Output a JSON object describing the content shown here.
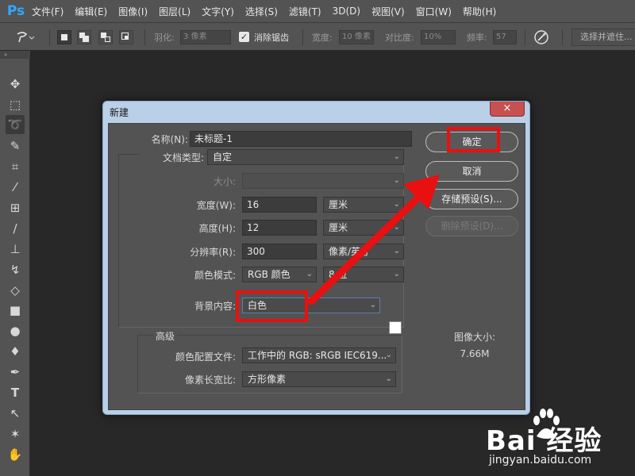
{
  "app": {
    "logo": "Ps"
  },
  "menu": [
    "文件(F)",
    "编辑(E)",
    "图像(I)",
    "图层(L)",
    "文字(Y)",
    "选择(S)",
    "滤镜(T)",
    "3D(D)",
    "视图(V)",
    "窗口(W)",
    "帮助(H)"
  ],
  "options_bar": {
    "tool_icon": "magnetic-lasso-icon",
    "feather_label": "羽化:",
    "feather_value": "3 像素",
    "antialias_label": "消除锯齿",
    "antialias_checked": true,
    "width_label": "宽度:",
    "width_value": "10 像素",
    "contrast_label": "对比度:",
    "contrast_value": "10%",
    "frequency_label": "频率:",
    "frequency_value": "57",
    "select_mask_label": "选择并遮住..."
  },
  "toolbar": {
    "collapse_glyph": "»",
    "tools": [
      {
        "name": "move-tool",
        "glyph": "✥"
      },
      {
        "name": "marquee-tool",
        "glyph": "⬚"
      },
      {
        "name": "lasso-tool",
        "glyph": "➰",
        "active": true
      },
      {
        "name": "quick-select-tool",
        "glyph": "✎"
      },
      {
        "name": "crop-tool",
        "glyph": "⌗"
      },
      {
        "name": "eyedropper-tool",
        "glyph": "⁄"
      },
      {
        "name": "healing-tool",
        "glyph": "⊞"
      },
      {
        "name": "brush-tool",
        "glyph": "∕"
      },
      {
        "name": "stamp-tool",
        "glyph": "⊥"
      },
      {
        "name": "history-brush-tool",
        "glyph": "↯"
      },
      {
        "name": "eraser-tool",
        "glyph": "◇"
      },
      {
        "name": "gradient-tool",
        "glyph": "■"
      },
      {
        "name": "blur-tool",
        "glyph": "●"
      },
      {
        "name": "dodge-tool",
        "glyph": "♦"
      },
      {
        "name": "pen-tool",
        "glyph": "✒"
      },
      {
        "name": "type-tool",
        "glyph": "T"
      },
      {
        "name": "path-select-tool",
        "glyph": "↖"
      },
      {
        "name": "shape-tool",
        "glyph": "✶"
      },
      {
        "name": "hand-tool",
        "glyph": "✋"
      }
    ]
  },
  "dialog": {
    "title": "新建",
    "close_glyph": "×",
    "name_label": "名称(N):",
    "name_value": "未标题-1",
    "doc_type_label": "文档类型:",
    "doc_type_value": "自定",
    "size_label": "大小:",
    "size_value": "",
    "width_label": "宽度(W):",
    "width_value": "16",
    "width_unit": "厘米",
    "height_label": "高度(H):",
    "height_value": "12",
    "height_unit": "厘米",
    "resolution_label": "分辨率(R):",
    "resolution_value": "300",
    "resolution_unit": "像素/英寸",
    "color_mode_label": "颜色模式:",
    "color_mode_value": "RGB 颜色",
    "bit_depth_value": "8 位",
    "bg_label": "背景内容:",
    "bg_value": "白色",
    "bg_swatch_color": "#ffffff",
    "advanced_label": "高级",
    "color_profile_label": "颜色配置文件:",
    "color_profile_value": "工作中的 RGB: sRGB IEC619...",
    "pixel_aspect_label": "像素长宽比:",
    "pixel_aspect_value": "方形像素",
    "buttons": {
      "ok": "确定",
      "cancel": "取消",
      "save_preset": "存储预设(S)...",
      "delete_preset": "删除预设(D)..."
    },
    "image_size_label": "图像大小:",
    "image_size_value": "7.66M"
  },
  "annotation": {
    "color": "#e81010"
  },
  "watermark": {
    "logo": "Bai  经验",
    "sub": "jingyan.baidu.com"
  }
}
